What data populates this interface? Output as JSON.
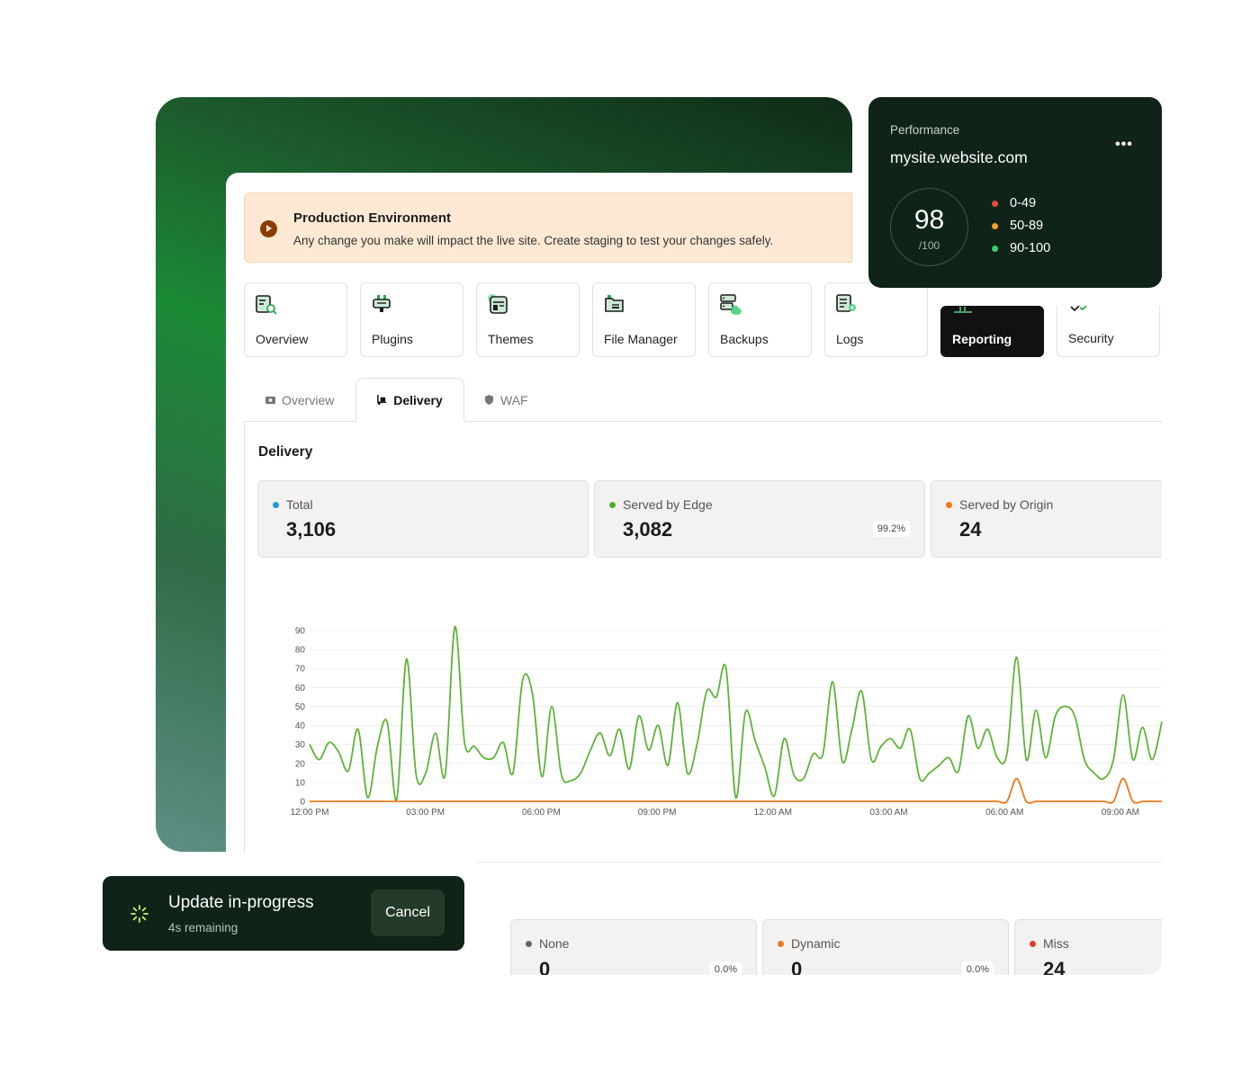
{
  "banner": {
    "title": "Production Environment",
    "text": "Any change you make will impact the live site. Create staging to test your changes safely."
  },
  "modules": [
    {
      "label": "Overview",
      "icon": "overview-icon"
    },
    {
      "label": "Plugins",
      "icon": "plug-icon"
    },
    {
      "label": "Themes",
      "icon": "themes-icon"
    },
    {
      "label": "File Manager",
      "icon": "folder-icon"
    },
    {
      "label": "Backups",
      "icon": "backup-cloud-icon"
    },
    {
      "label": "Logs",
      "icon": "logs-icon"
    },
    {
      "label": "Reporting",
      "icon": "reporting-icon",
      "active": true
    },
    {
      "label": "Security",
      "icon": "shield-check-icon"
    }
  ],
  "tabs": [
    {
      "label": "Overview",
      "icon": "camera-icon"
    },
    {
      "label": "Delivery",
      "icon": "delivery-icon",
      "active": true
    },
    {
      "label": "WAF",
      "icon": "shield-icon"
    }
  ],
  "section_title": "Delivery",
  "stats": [
    {
      "label": "Total",
      "value": "3,106",
      "color": "#1e9bd7"
    },
    {
      "label": "Served by Edge",
      "value": "3,082",
      "percent": "99.2%",
      "color": "#4caf2e"
    },
    {
      "label": "Served by Origin",
      "value": "24",
      "color": "#ee7a1a"
    }
  ],
  "bottom_stats": [
    {
      "label": "None",
      "value": "0",
      "percent": "0.0%",
      "color": "#666666"
    },
    {
      "label": "Dynamic",
      "value": "0",
      "percent": "0.0%",
      "color": "#ee7a1a"
    },
    {
      "label": "Miss",
      "value": "24",
      "color": "#e0401a"
    }
  ],
  "chart_data": {
    "type": "line",
    "x": [
      "12:00 PM",
      "03:00 PM",
      "06:00 PM",
      "09:00 PM",
      "12:00 AM",
      "03:00 AM",
      "06:00 AM",
      "09:00 AM"
    ],
    "yticks": [
      0,
      10,
      20,
      30,
      40,
      50,
      60,
      70,
      80,
      90
    ],
    "ylim": [
      0,
      90
    ],
    "series": [
      {
        "color": "#5fb33a",
        "values": [
          30,
          22,
          31,
          26,
          16,
          38,
          2,
          29,
          42,
          1,
          75,
          14,
          15,
          36,
          14,
          92,
          31,
          29,
          23,
          23,
          31,
          15,
          64,
          57,
          13,
          50,
          14,
          11,
          15,
          27,
          36,
          24,
          38,
          17,
          45,
          27,
          40,
          19,
          52,
          15,
          30,
          58,
          55,
          70,
          2,
          47,
          32,
          18,
          3,
          33,
          14,
          12,
          25,
          25,
          63,
          21,
          38,
          58,
          22,
          29,
          33,
          28,
          38,
          12,
          15,
          19,
          23,
          16,
          45,
          28,
          38,
          23,
          25,
          76,
          22,
          48,
          23,
          45,
          50,
          45,
          22,
          15,
          12,
          22,
          56,
          22,
          39,
          22,
          42
        ]
      },
      {
        "color": "#ee7a1a",
        "values": [
          0,
          0,
          0,
          0,
          0,
          0,
          0,
          0,
          0,
          0,
          0,
          0,
          0,
          0,
          0,
          0,
          0,
          0,
          0,
          0,
          0,
          0,
          0,
          0,
          0,
          0,
          0,
          0,
          0,
          0,
          0,
          0,
          0,
          0,
          0,
          0,
          0,
          0,
          0,
          0,
          0,
          0,
          0,
          0,
          0,
          0,
          0,
          0,
          0,
          0,
          0,
          0,
          0,
          0,
          0,
          0,
          0,
          0,
          0,
          0,
          0,
          0,
          0,
          0,
          0,
          0,
          0,
          0,
          0,
          0,
          0,
          0,
          0,
          12,
          0,
          0,
          0,
          0,
          0,
          0,
          0,
          0,
          0,
          0,
          12,
          0,
          0,
          0,
          0
        ]
      }
    ]
  },
  "performance": {
    "label": "Performance",
    "site": "mysite.website.com",
    "score": "98",
    "max": "/100",
    "legend": [
      {
        "label": "0-49",
        "color": "#e84a3c"
      },
      {
        "label": "50-89",
        "color": "#f0a02c"
      },
      {
        "label": "90-100",
        "color": "#35d06a"
      }
    ]
  },
  "toast": {
    "title": "Update in-progress",
    "sub": "4s remaining",
    "cancel": "Cancel"
  }
}
